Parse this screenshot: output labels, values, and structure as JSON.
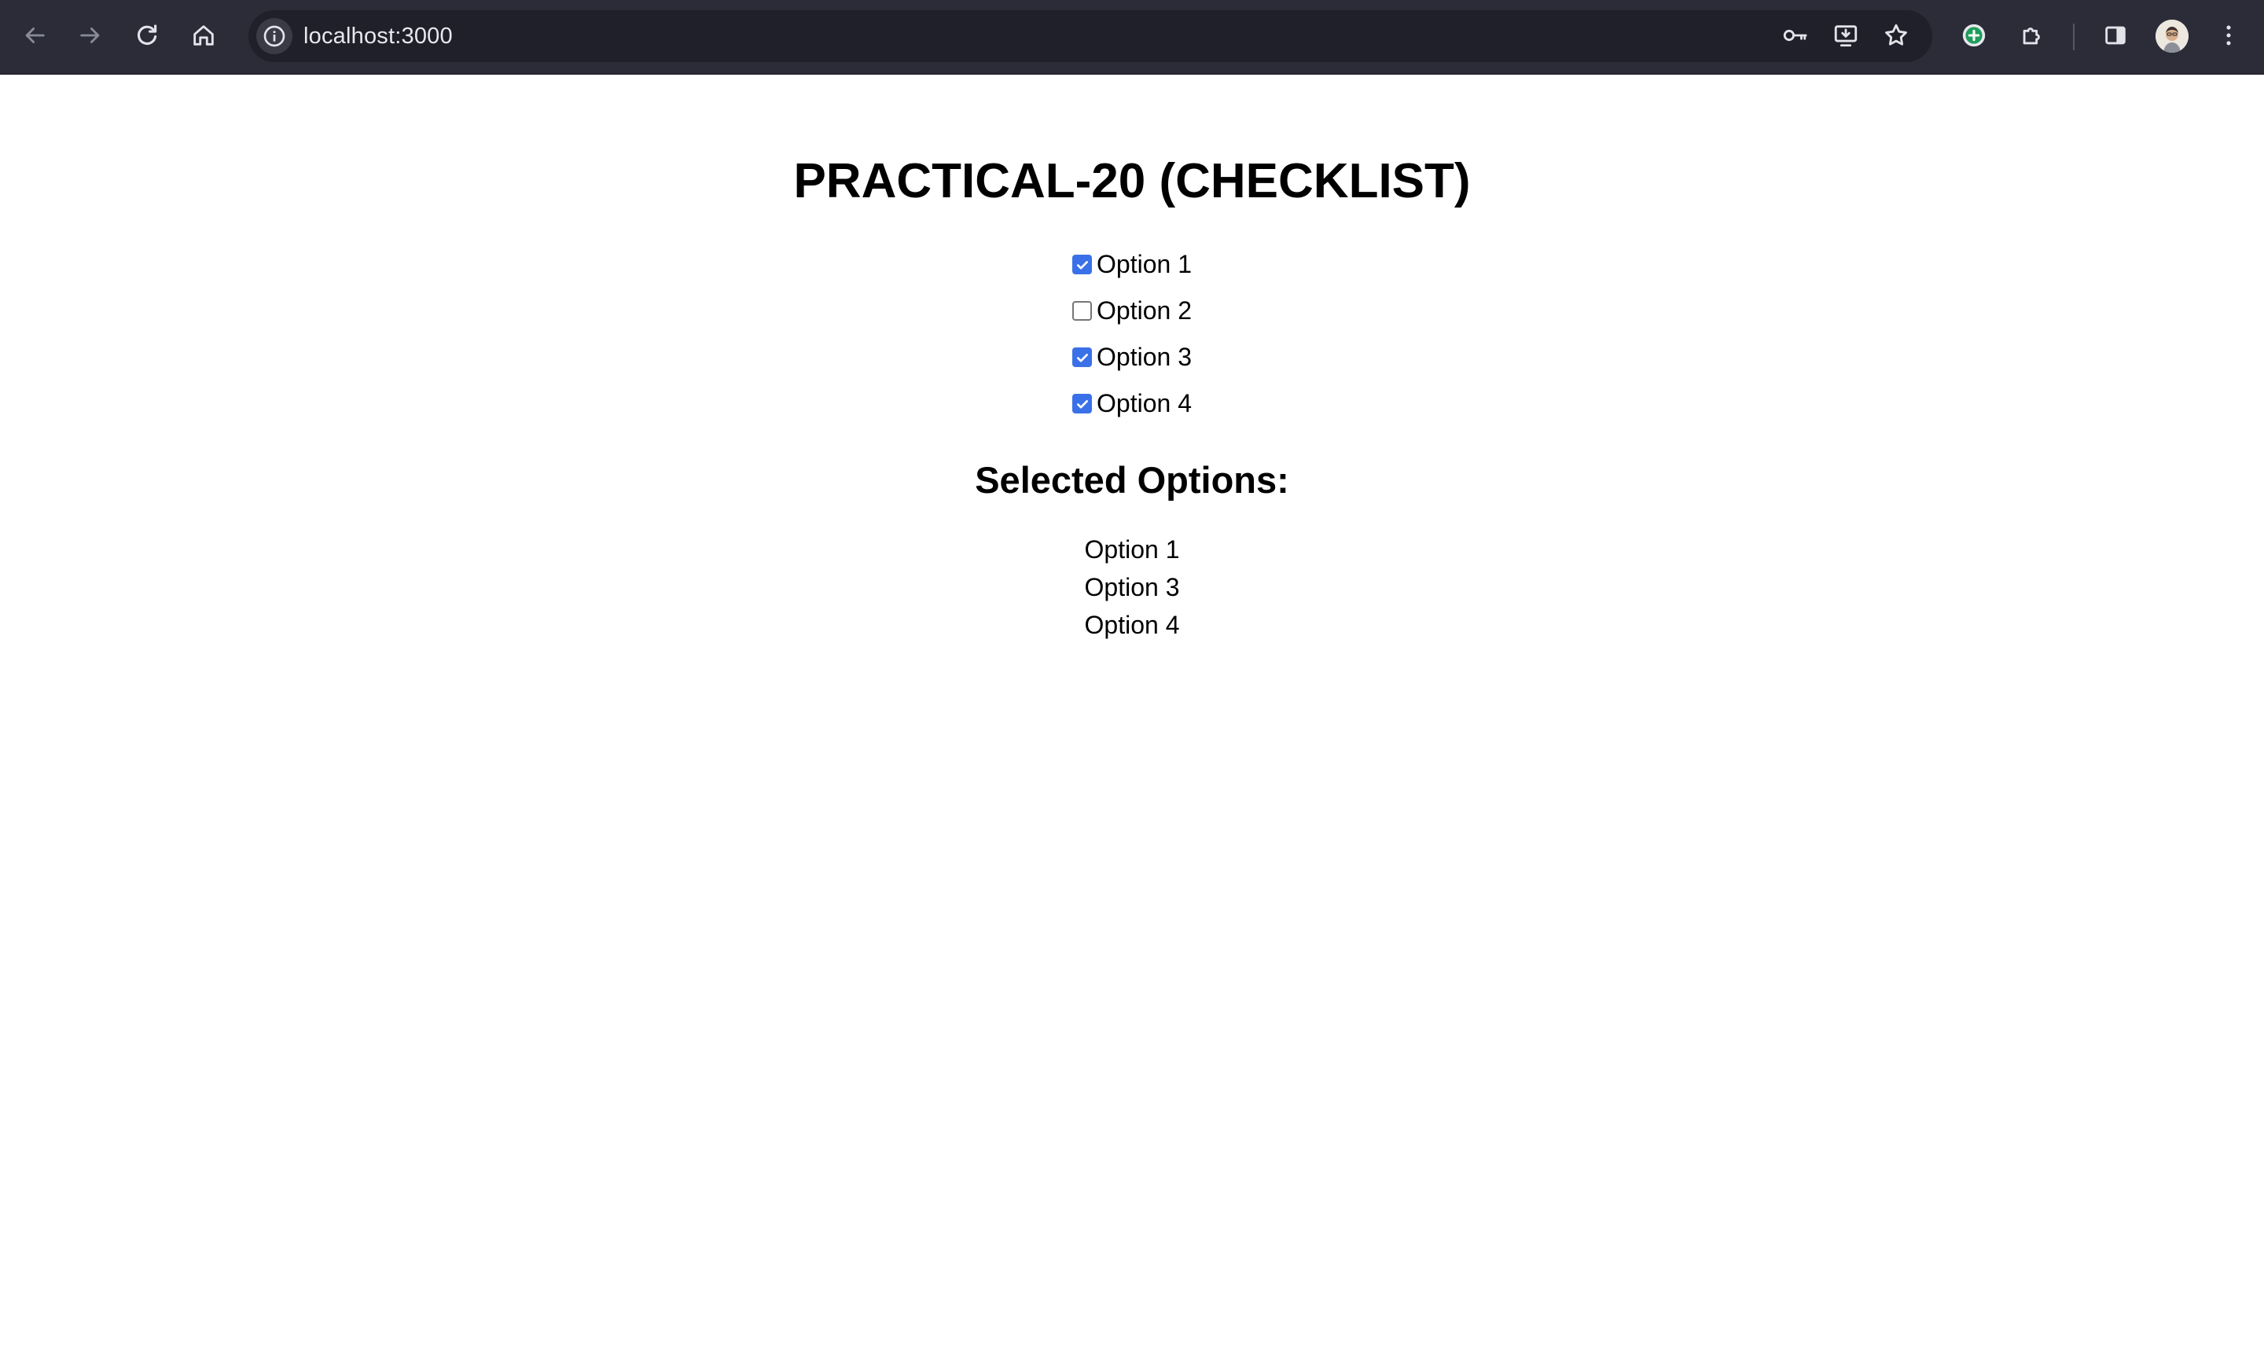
{
  "browser": {
    "url": "localhost:3000",
    "toolbar_color": "#2b2c38"
  },
  "page": {
    "title": "PRACTICAL-20 (CHECKLIST)",
    "options": [
      {
        "label": "Option 1",
        "checked": true
      },
      {
        "label": "Option 2",
        "checked": false
      },
      {
        "label": "Option 3",
        "checked": true
      },
      {
        "label": "Option 4",
        "checked": true
      }
    ],
    "selected_heading": "Selected Options:",
    "selected": [
      "Option 1",
      "Option 3",
      "Option 4"
    ],
    "checkbox_color": "#3a71e8"
  }
}
